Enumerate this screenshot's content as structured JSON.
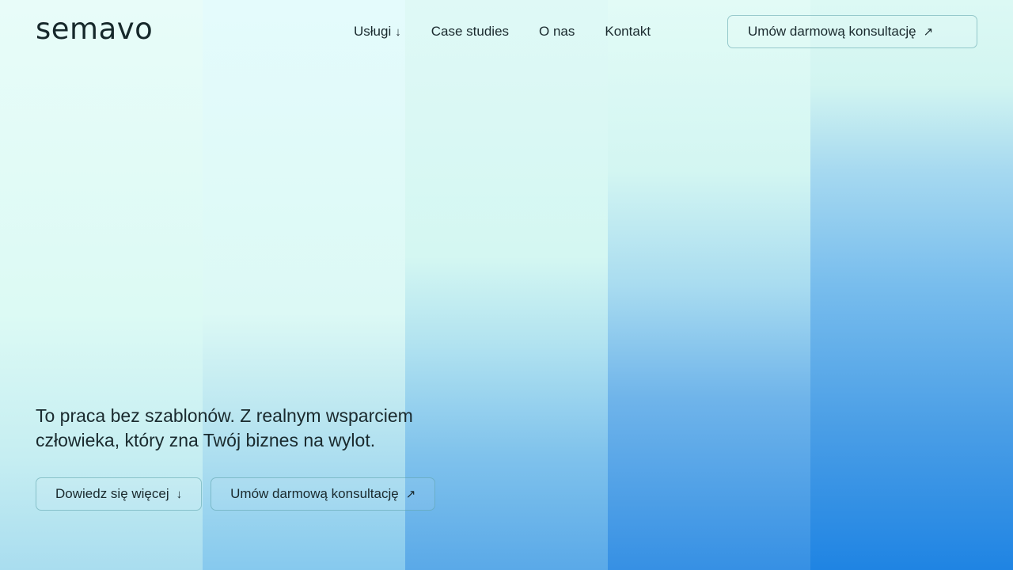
{
  "brand": {
    "logo_text": "semavo"
  },
  "nav": {
    "items": [
      {
        "label": "Usługi",
        "icon": "arrow-down-icon",
        "arrow": "↓"
      },
      {
        "label": "Case studies"
      },
      {
        "label": "O nas"
      },
      {
        "label": "Kontakt"
      }
    ],
    "cta_label": "Umów darmową konsultację",
    "cta_icon": "arrow-up-right-icon",
    "cta_arrow": "↗"
  },
  "hero": {
    "line1": "To praca bez szablonów. Z realnym wsparciem",
    "line2": "człowieka, który zna Twój biznes na wylot.",
    "buttons": [
      {
        "label": "Dowiedz się więcej",
        "icon": "arrow-down-icon",
        "arrow": "↓"
      },
      {
        "label": "Umów darmową konsultację",
        "icon": "arrow-up-right-icon",
        "arrow": "↗"
      }
    ]
  },
  "colors": {
    "text": "#1a2a2e",
    "accent_blue": "#1f84e3",
    "mint": "#dcfaf4"
  }
}
